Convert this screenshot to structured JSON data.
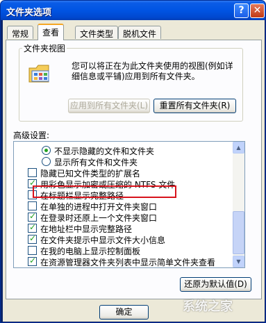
{
  "window": {
    "title": "文件夹选项",
    "help_label": "?",
    "close_label": "✕"
  },
  "tabs": [
    {
      "label": "常规"
    },
    {
      "label": "查看"
    },
    {
      "label": "文件类型"
    },
    {
      "label": "脱机文件"
    }
  ],
  "folder_views": {
    "legend": "文件夹视图",
    "description": "您可以将正在为此文件夹使用的视图(例如详细信息或平铺)应用到所有文件夹。",
    "apply_all_label": "应用到所有文件夹(L)",
    "reset_all_label": "重置所有文件夹(R)"
  },
  "advanced": {
    "label": "高级设置:",
    "items": [
      {
        "type": "radio",
        "checked": true,
        "indent": 2,
        "label": "不显示隐藏的文件和文件夹"
      },
      {
        "type": "radio",
        "checked": false,
        "indent": 2,
        "label": "显示所有文件和文件夹"
      },
      {
        "type": "checkbox",
        "checked": false,
        "indent": 1,
        "label": "隐藏已知文件类型的扩展名"
      },
      {
        "type": "checkbox",
        "checked": true,
        "indent": 1,
        "label": "用彩色显示加密或压缩的 NTFS 文件"
      },
      {
        "type": "checkbox",
        "checked": false,
        "indent": 1,
        "label": "在标题栏显示完整路径"
      },
      {
        "type": "checkbox",
        "checked": false,
        "indent": 1,
        "label": "在单独的进程中打开文件夹窗口"
      },
      {
        "type": "checkbox",
        "checked": true,
        "indent": 1,
        "label": "在登录时还原上一个文件夹窗口"
      },
      {
        "type": "checkbox",
        "checked": true,
        "indent": 1,
        "label": "在地址栏中显示完整路径"
      },
      {
        "type": "checkbox",
        "checked": true,
        "indent": 1,
        "label": "在文件夹提示中显示文件大小信息"
      },
      {
        "type": "checkbox",
        "checked": false,
        "indent": 1,
        "label": "在我的电脑上显示控制面板"
      },
      {
        "type": "checkbox",
        "checked": true,
        "indent": 1,
        "label": "在资源管理器文件夹列表中显示简单文件夹查看"
      }
    ],
    "restore_defaults_label": "还原为默认值(D)"
  },
  "footer": {
    "ok_label": "确定"
  },
  "watermark": "系统之家",
  "colors": {
    "highlight": "#d8121b",
    "titlebar": "#0054e3"
  }
}
